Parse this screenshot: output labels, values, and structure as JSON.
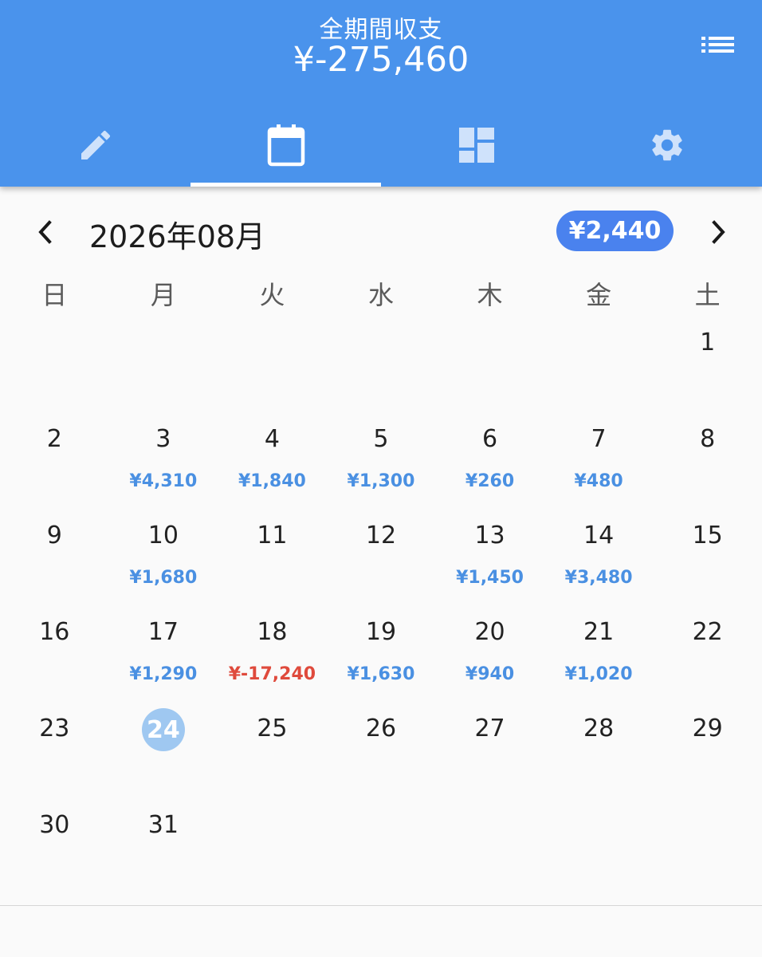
{
  "header": {
    "title": "全期間収支",
    "total": "¥-275,460",
    "menu_icon": "list-icon"
  },
  "tabs": [
    {
      "icon": "pencil-icon",
      "active": false
    },
    {
      "icon": "calendar-icon",
      "active": true
    },
    {
      "icon": "dashboard-icon",
      "active": false
    },
    {
      "icon": "gear-icon",
      "active": false
    }
  ],
  "month_nav": {
    "prev_icon": "chevron-left-icon",
    "next_icon": "chevron-right-icon",
    "title": "2026年08月",
    "total": "¥2,440"
  },
  "weekdays": [
    "日",
    "月",
    "火",
    "水",
    "木",
    "金",
    "土"
  ],
  "weeks": [
    [
      {
        "day": ""
      },
      {
        "day": ""
      },
      {
        "day": ""
      },
      {
        "day": ""
      },
      {
        "day": ""
      },
      {
        "day": ""
      },
      {
        "day": "1"
      }
    ],
    [
      {
        "day": "2"
      },
      {
        "day": "3",
        "amount": "¥4,310"
      },
      {
        "day": "4",
        "amount": "¥1,840"
      },
      {
        "day": "5",
        "amount": "¥1,300"
      },
      {
        "day": "6",
        "amount": "¥260"
      },
      {
        "day": "7",
        "amount": "¥480"
      },
      {
        "day": "8"
      }
    ],
    [
      {
        "day": "9"
      },
      {
        "day": "10",
        "amount": "¥1,680"
      },
      {
        "day": "11"
      },
      {
        "day": "12"
      },
      {
        "day": "13",
        "amount": "¥1,450"
      },
      {
        "day": "14",
        "amount": "¥3,480"
      },
      {
        "day": "15"
      }
    ],
    [
      {
        "day": "16"
      },
      {
        "day": "17",
        "amount": "¥1,290"
      },
      {
        "day": "18",
        "amount": "¥-17,240",
        "negative": true
      },
      {
        "day": "19",
        "amount": "¥1,630"
      },
      {
        "day": "20",
        "amount": "¥940"
      },
      {
        "day": "21",
        "amount": "¥1,020"
      },
      {
        "day": "22"
      }
    ],
    [
      {
        "day": "23"
      },
      {
        "day": "24",
        "today": true
      },
      {
        "day": "25"
      },
      {
        "day": "26"
      },
      {
        "day": "27"
      },
      {
        "day": "28"
      },
      {
        "day": "29"
      }
    ],
    [
      {
        "day": "30"
      },
      {
        "day": "31"
      },
      {
        "day": ""
      },
      {
        "day": ""
      },
      {
        "day": ""
      },
      {
        "day": ""
      },
      {
        "day": ""
      }
    ]
  ],
  "colors": {
    "primary": "#4a93ec",
    "income": "#4a90e2",
    "expense": "#df4a3c",
    "today_bg": "#9fc8f1",
    "month_total_bg": "#4a82ee"
  }
}
